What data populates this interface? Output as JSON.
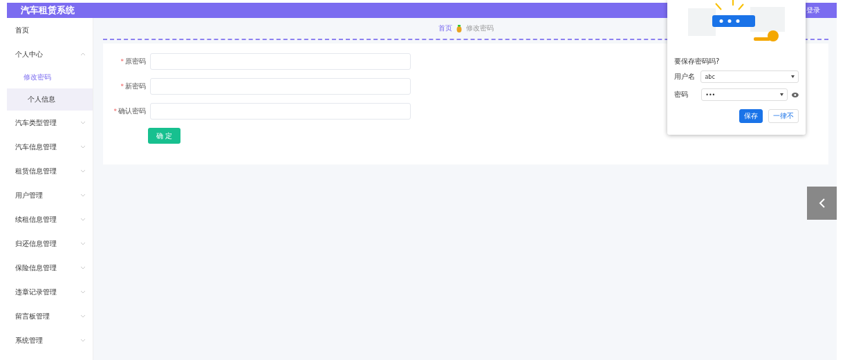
{
  "header": {
    "title": "汽车租赁系统",
    "right_link": "登录"
  },
  "sidebar": {
    "items": [
      {
        "label": "首页",
        "has_children": false
      },
      {
        "label": "个人中心",
        "has_children": true,
        "expanded": true,
        "children": [
          {
            "label": "修改密码",
            "selected": true,
            "hovered": false
          },
          {
            "label": "个人信息",
            "selected": false,
            "hovered": true
          }
        ]
      },
      {
        "label": "汽车类型管理",
        "has_children": true,
        "expanded": false
      },
      {
        "label": "汽车信息管理",
        "has_children": true,
        "expanded": false
      },
      {
        "label": "租赁信息管理",
        "has_children": true,
        "expanded": false
      },
      {
        "label": "用户管理",
        "has_children": true,
        "expanded": false
      },
      {
        "label": "续租信息管理",
        "has_children": true,
        "expanded": false
      },
      {
        "label": "归还信息管理",
        "has_children": true,
        "expanded": false
      },
      {
        "label": "保险信息管理",
        "has_children": true,
        "expanded": false
      },
      {
        "label": "违章记录管理",
        "has_children": true,
        "expanded": false
      },
      {
        "label": "留言板管理",
        "has_children": true,
        "expanded": false
      },
      {
        "label": "系统管理",
        "has_children": true,
        "expanded": false
      }
    ]
  },
  "breadcrumb": [
    "首页",
    "修改密码"
  ],
  "form": {
    "fields": [
      {
        "label": "原密码",
        "required_mark": "*"
      },
      {
        "label": "新密码",
        "required_mark": "*"
      },
      {
        "label": "确认密码",
        "required_mark": "*"
      }
    ],
    "submit": "确 定"
  },
  "save_password_popup": {
    "title": "要保存密码吗?",
    "username_label": "用户名",
    "username": "abc",
    "password_label": "密码",
    "password": "•••",
    "save": "保存",
    "never": "一律不"
  }
}
